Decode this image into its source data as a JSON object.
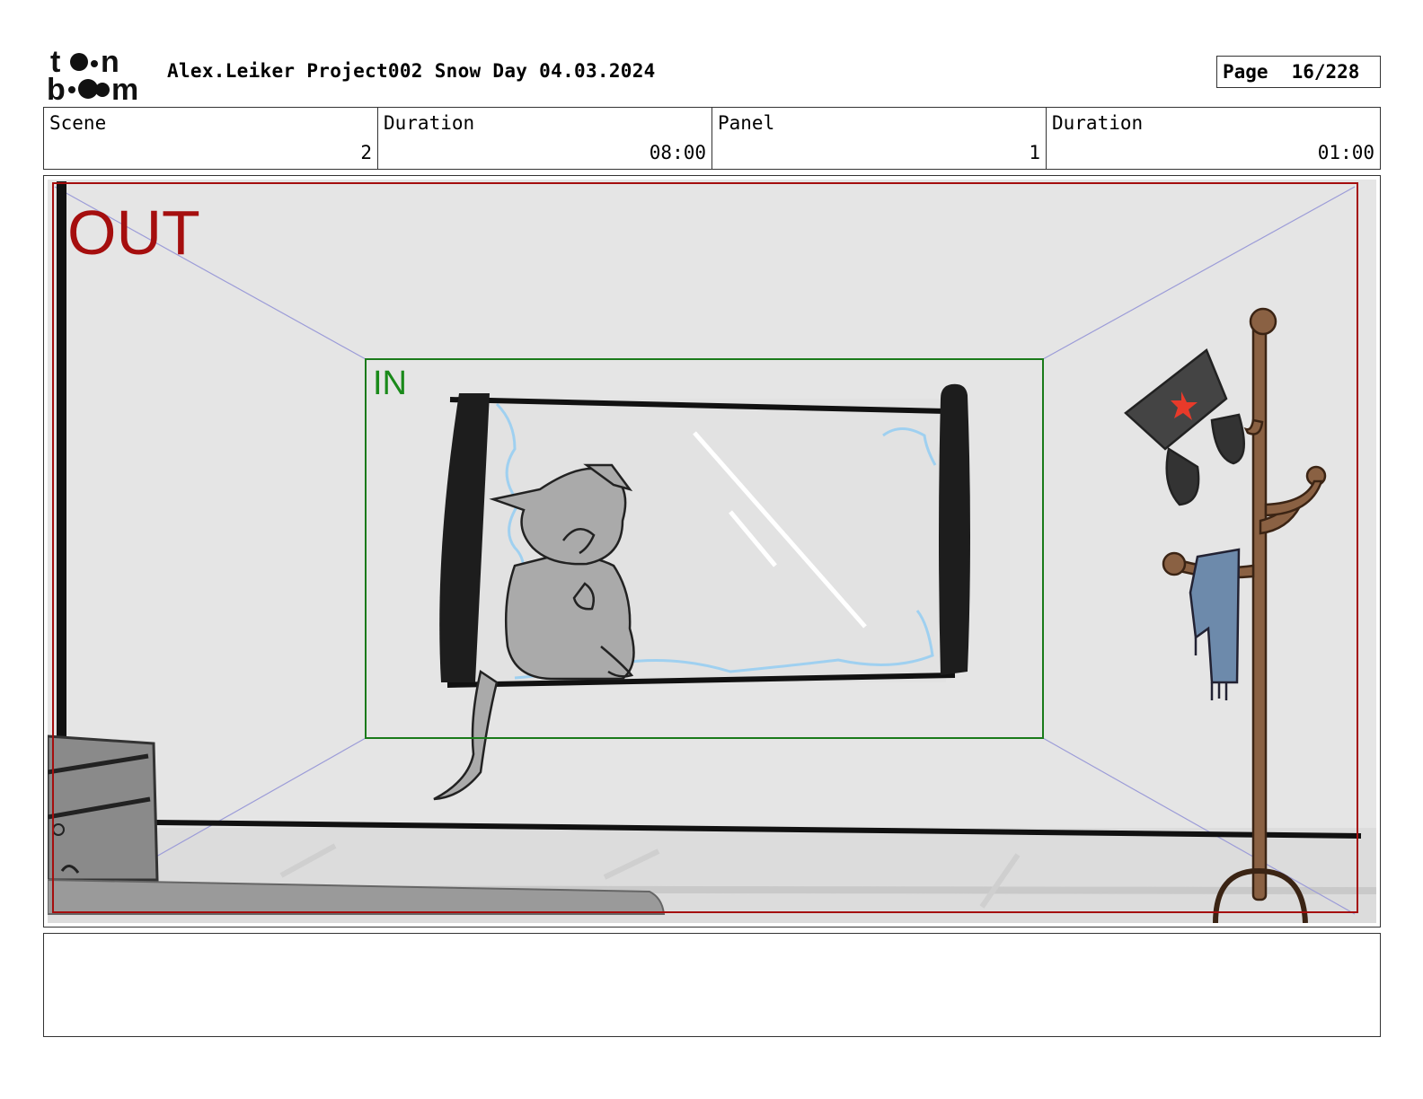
{
  "header": {
    "logo_text": "toon boom",
    "title": "Alex.Leiker Project002 Snow Day 04.03.2024",
    "page_label": "Page",
    "page_value": "16/228"
  },
  "info": {
    "scene_label": "Scene",
    "scene_value": "2",
    "scene_duration_label": "Duration",
    "scene_duration_value": "08:00",
    "panel_label": "Panel",
    "panel_value": "1",
    "panel_duration_label": "Duration",
    "panel_duration_value": "01:00"
  },
  "panel": {
    "out_label": "OUT",
    "in_label": "IN",
    "out_color": "#a50e0e",
    "in_color": "#1a8a1a",
    "guide_color": "#9c9cd8"
  },
  "notes": {
    "text": ""
  }
}
